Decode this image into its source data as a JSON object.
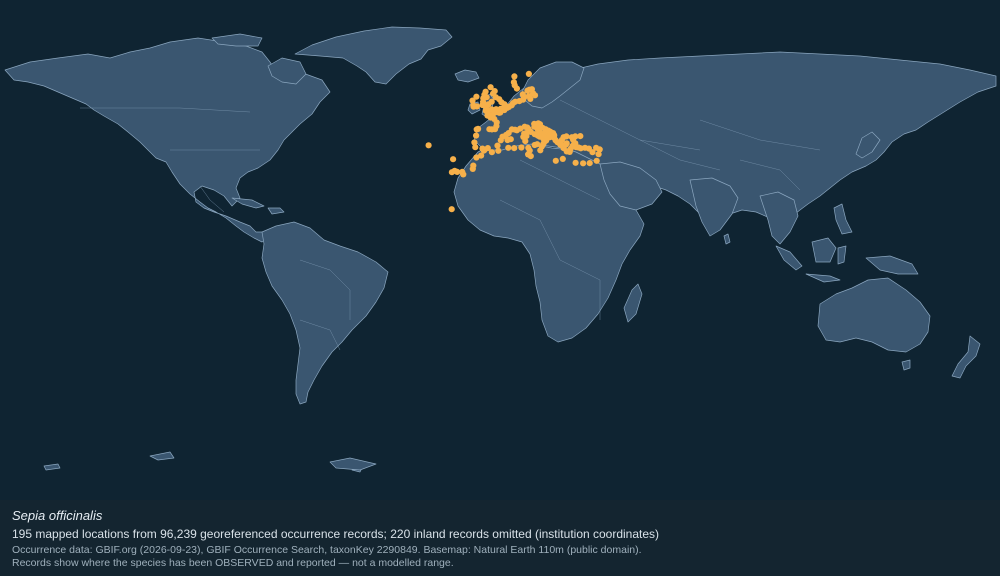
{
  "map": {
    "basemap_style": {
      "ocean_color": "#0f2432",
      "land_color": "#3a5670",
      "border_color": "#8aa6bf"
    },
    "occurrence_marker_color": "#f6b04a",
    "occurrences": [
      {
        "lon": -9.2,
        "lat": 38.7
      },
      {
        "lon": -8.9,
        "lat": 37.0
      },
      {
        "lon": -8.6,
        "lat": 41.2
      },
      {
        "lon": -8.4,
        "lat": 43.4
      },
      {
        "lon": -7.9,
        "lat": 43.6
      },
      {
        "lon": -6.3,
        "lat": 36.5
      },
      {
        "lon": -5.6,
        "lat": 36.0
      },
      {
        "lon": -4.4,
        "lat": 36.7
      },
      {
        "lon": -3.8,
        "lat": 43.5
      },
      {
        "lon": -2.9,
        "lat": 43.4
      },
      {
        "lon": -1.8,
        "lat": 43.5
      },
      {
        "lon": -1.3,
        "lat": 44.6
      },
      {
        "lon": -1.2,
        "lat": 45.9
      },
      {
        "lon": -2.1,
        "lat": 47.2
      },
      {
        "lon": -3.4,
        "lat": 47.7
      },
      {
        "lon": -4.5,
        "lat": 48.4
      },
      {
        "lon": -4.1,
        "lat": 48.7
      },
      {
        "lon": -2.7,
        "lat": 48.6
      },
      {
        "lon": -1.6,
        "lat": 49.6
      },
      {
        "lon": -0.3,
        "lat": 49.4
      },
      {
        "lon": 0.1,
        "lat": 49.5
      },
      {
        "lon": 1.6,
        "lat": 50.4
      },
      {
        "lon": 1.9,
        "lat": 51.0
      },
      {
        "lon": 2.6,
        "lat": 51.2
      },
      {
        "lon": 3.2,
        "lat": 51.5
      },
      {
        "lon": 4.2,
        "lat": 52.1
      },
      {
        "lon": 4.7,
        "lat": 52.9
      },
      {
        "lon": 5.5,
        "lat": 53.4
      },
      {
        "lon": 7.0,
        "lat": 53.6
      },
      {
        "lon": 8.3,
        "lat": 54.1
      },
      {
        "lon": 8.7,
        "lat": 55.0
      },
      {
        "lon": 8.2,
        "lat": 56.0
      },
      {
        "lon": 9.9,
        "lat": 57.4
      },
      {
        "lon": 10.6,
        "lat": 57.7
      },
      {
        "lon": 11.5,
        "lat": 57.9
      },
      {
        "lon": 11.9,
        "lat": 56.4
      },
      {
        "lon": 12.6,
        "lat": 55.7
      },
      {
        "lon": 10.4,
        "lat": 55.4
      },
      {
        "lon": 10.9,
        "lat": 54.4
      },
      {
        "lon": 6.1,
        "lat": 58.1
      },
      {
        "lon": 5.3,
        "lat": 59.3
      },
      {
        "lon": 5.0,
        "lat": 60.4
      },
      {
        "lon": 5.2,
        "lat": 62.5
      },
      {
        "lon": 10.4,
        "lat": 63.4
      },
      {
        "lon": -5.1,
        "lat": 50.1
      },
      {
        "lon": -4.1,
        "lat": 50.3
      },
      {
        "lon": -3.0,
        "lat": 50.6
      },
      {
        "lon": -1.4,
        "lat": 50.7
      },
      {
        "lon": 0.2,
        "lat": 50.8
      },
      {
        "lon": 1.3,
        "lat": 51.1
      },
      {
        "lon": 1.6,
        "lat": 52.5
      },
      {
        "lon": 0.5,
        "lat": 53.2
      },
      {
        "lon": -0.3,
        "lat": 54.3
      },
      {
        "lon": -1.5,
        "lat": 55.0
      },
      {
        "lon": -2.5,
        "lat": 56.3
      },
      {
        "lon": -1.9,
        "lat": 57.2
      },
      {
        "lon": -3.4,
        "lat": 58.6
      },
      {
        "lon": -5.2,
        "lat": 57.0
      },
      {
        "lon": -5.6,
        "lat": 55.9
      },
      {
        "lon": -4.8,
        "lat": 55.0
      },
      {
        "lon": -3.0,
        "lat": 53.4
      },
      {
        "lon": -4.2,
        "lat": 52.4
      },
      {
        "lon": -5.1,
        "lat": 51.7
      },
      {
        "lon": -6.3,
        "lat": 52.2
      },
      {
        "lon": -6.1,
        "lat": 53.3
      },
      {
        "lon": -6.0,
        "lat": 54.6
      },
      {
        "lon": -8.5,
        "lat": 55.2
      },
      {
        "lon": -9.9,
        "lat": 53.8
      },
      {
        "lon": -9.6,
        "lat": 52.1
      },
      {
        "lon": -8.3,
        "lat": 51.7
      },
      {
        "lon": -9.5,
        "lat": 51.6
      },
      {
        "lon": -2.0,
        "lat": 49.4
      },
      {
        "lon": -0.9,
        "lat": 37.6
      },
      {
        "lon": 0.3,
        "lat": 39.5
      },
      {
        "lon": 0.9,
        "lat": 40.8
      },
      {
        "lon": 2.2,
        "lat": 41.4
      },
      {
        "lon": 3.1,
        "lat": 42.1
      },
      {
        "lon": 2.7,
        "lat": 39.6
      },
      {
        "lon": 3.9,
        "lat": 39.9
      },
      {
        "lon": 4.3,
        "lat": 43.4
      },
      {
        "lon": 5.4,
        "lat": 43.3
      },
      {
        "lon": 6.1,
        "lat": 43.1
      },
      {
        "lon": 7.3,
        "lat": 43.7
      },
      {
        "lon": 8.9,
        "lat": 44.4
      },
      {
        "lon": 9.8,
        "lat": 44.1
      },
      {
        "lon": 10.3,
        "lat": 43.5
      },
      {
        "lon": 11.1,
        "lat": 42.5
      },
      {
        "lon": 12.5,
        "lat": 41.7
      },
      {
        "lon": 13.6,
        "lat": 41.2
      },
      {
        "lon": 14.3,
        "lat": 40.8
      },
      {
        "lon": 15.6,
        "lat": 40.1
      },
      {
        "lon": 16.0,
        "lat": 38.9
      },
      {
        "lon": 15.6,
        "lat": 38.2
      },
      {
        "lon": 16.6,
        "lat": 39.4
      },
      {
        "lon": 17.2,
        "lat": 40.4
      },
      {
        "lon": 18.0,
        "lat": 40.6
      },
      {
        "lon": 16.9,
        "lat": 41.1
      },
      {
        "lon": 15.9,
        "lat": 41.9
      },
      {
        "lon": 14.2,
        "lat": 42.5
      },
      {
        "lon": 13.5,
        "lat": 43.6
      },
      {
        "lon": 12.4,
        "lat": 44.4
      },
      {
        "lon": 12.3,
        "lat": 45.4
      },
      {
        "lon": 13.8,
        "lat": 45.6
      },
      {
        "lon": 14.4,
        "lat": 45.3
      },
      {
        "lon": 15.3,
        "lat": 44.0
      },
      {
        "lon": 16.4,
        "lat": 43.5
      },
      {
        "lon": 17.4,
        "lat": 43.0
      },
      {
        "lon": 18.1,
        "lat": 42.6
      },
      {
        "lon": 19.1,
        "lat": 42.1
      },
      {
        "lon": 19.5,
        "lat": 41.3
      },
      {
        "lon": 19.5,
        "lat": 40.4
      },
      {
        "lon": 20.0,
        "lat": 39.5
      },
      {
        "lon": 20.7,
        "lat": 38.8
      },
      {
        "lon": 21.7,
        "lat": 37.9
      },
      {
        "lon": 22.9,
        "lat": 36.7
      },
      {
        "lon": 22.4,
        "lat": 37.6
      },
      {
        "lon": 23.7,
        "lat": 37.9
      },
      {
        "lon": 24.0,
        "lat": 38.4
      },
      {
        "lon": 22.9,
        "lat": 40.6
      },
      {
        "lon": 23.9,
        "lat": 40.9
      },
      {
        "lon": 25.9,
        "lat": 40.6
      },
      {
        "lon": 26.3,
        "lat": 39.7
      },
      {
        "lon": 27.1,
        "lat": 38.4
      },
      {
        "lon": 27.4,
        "lat": 37.0
      },
      {
        "lon": 28.3,
        "lat": 36.9
      },
      {
        "lon": 29.1,
        "lat": 36.6
      },
      {
        "lon": 30.6,
        "lat": 36.8
      },
      {
        "lon": 32.0,
        "lat": 36.5
      },
      {
        "lon": 34.6,
        "lat": 36.8
      },
      {
        "lon": 35.9,
        "lat": 36.2
      },
      {
        "lon": 35.5,
        "lat": 34.5
      },
      {
        "lon": 33.3,
        "lat": 35.2
      },
      {
        "lon": 25.1,
        "lat": 35.3
      },
      {
        "lon": 24.0,
        "lat": 35.5
      },
      {
        "lon": 26.1,
        "lat": 37.4
      },
      {
        "lon": 25.4,
        "lat": 36.4
      },
      {
        "lon": 28.9,
        "lat": 41.0
      },
      {
        "lon": 14.5,
        "lat": 35.9
      },
      {
        "lon": 15.1,
        "lat": 37.3
      },
      {
        "lon": 13.4,
        "lat": 38.1
      },
      {
        "lon": 12.5,
        "lat": 37.8
      },
      {
        "lon": 9.1,
        "lat": 39.2
      },
      {
        "lon": 8.4,
        "lat": 40.7
      },
      {
        "lon": 9.5,
        "lat": 41.0
      },
      {
        "lon": 9.4,
        "lat": 42.1
      },
      {
        "lon": 8.7,
        "lat": 41.9
      },
      {
        "lon": 10.2,
        "lat": 36.8
      },
      {
        "lon": 10.7,
        "lat": 35.8
      },
      {
        "lon": 11.1,
        "lat": 33.8
      },
      {
        "lon": 10.1,
        "lat": 34.4
      },
      {
        "lon": 7.7,
        "lat": 36.9
      },
      {
        "lon": 5.1,
        "lat": 36.7
      },
      {
        "lon": 3.0,
        "lat": 36.8
      },
      {
        "lon": -0.6,
        "lat": 35.7
      },
      {
        "lon": -2.9,
        "lat": 35.2
      },
      {
        "lon": -5.8,
        "lat": 35.8
      },
      {
        "lon": -6.8,
        "lat": 34.0
      },
      {
        "lon": -8.5,
        "lat": 33.3
      },
      {
        "lon": -9.6,
        "lat": 30.4
      },
      {
        "lon": -9.8,
        "lat": 29.2
      },
      {
        "lon": -13.2,
        "lat": 27.2
      },
      {
        "lon": -13.6,
        "lat": 28.1
      },
      {
        "lon": -15.4,
        "lat": 28.1
      },
      {
        "lon": -16.3,
        "lat": 28.5
      },
      {
        "lon": -17.3,
        "lat": 28.0
      },
      {
        "lon": -16.9,
        "lat": 32.7
      },
      {
        "lon": -25.7,
        "lat": 37.7
      },
      {
        "lon": -17.4,
        "lat": 14.7
      },
      {
        "lon": 20.1,
        "lat": 32.1
      },
      {
        "lon": 22.6,
        "lat": 32.8
      },
      {
        "lon": 29.9,
        "lat": 31.2
      },
      {
        "lon": 32.3,
        "lat": 31.3
      },
      {
        "lon": 34.8,
        "lat": 32.1
      },
      {
        "lon": 27.2,
        "lat": 31.4
      },
      {
        "lon": 22.3,
        "lat": 39.6
      },
      {
        "lon": 27.1,
        "lat": 40.9
      },
      {
        "lon": 26.7,
        "lat": 38.2
      }
    ]
  },
  "caption": {
    "species": "Sepia officinalis",
    "summary": "195 mapped locations from 96,239 georeferenced occurrence records; 220 inland records omitted (institution coordinates)",
    "credit": "Occurrence data: GBIF.org (2026-09-23), GBIF Occurrence Search, taxonKey 2290849. Basemap: Natural Earth 110m (public domain).",
    "disclaimer": "Records show where the species has been OBSERVED and reported — not a modelled range."
  }
}
